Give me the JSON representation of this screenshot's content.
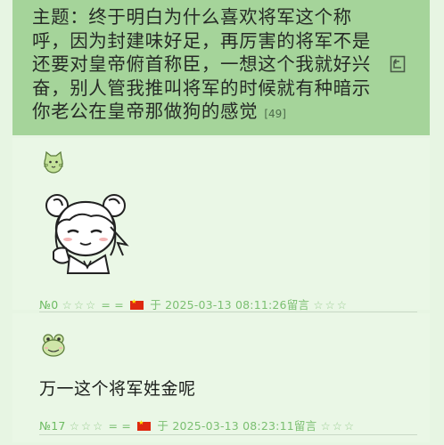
{
  "topic": {
    "text": "主题：终于明白为什么喜欢将军这个称呼，因为封建味好足，再厉害的将军不是还要对皇帝俯首称臣，一想这个我就好兴奋，别人管我推叫将军的时候就有种暗示你老公在皇帝那做狗的感觉",
    "reply_count": "[49]"
  },
  "posts": [
    {
      "avatar": "cat-avatar-icon",
      "content": "",
      "sticker": "anime-girl-sticker",
      "number": "№0",
      "stars_left": "☆☆☆",
      "equals": "= =",
      "flag": "china-flag-icon",
      "yu": "于",
      "datetime": "2025-03-13 08:11:26",
      "action": "留言",
      "stars_right": "☆☆☆"
    },
    {
      "avatar": "frog-avatar-icon",
      "content": "万一这个将军姓金呢",
      "number": "№17",
      "stars_left": "☆☆☆",
      "equals": "= =",
      "flag": "china-flag-icon",
      "yu": "于",
      "datetime": "2025-03-13 08:23:11",
      "action": "留言",
      "stars_right": "☆☆☆"
    }
  ],
  "colors": {
    "topic_bg": "#a5d49a",
    "post_bg": "#eaf7e6",
    "meta_green": "#7bbf71"
  }
}
